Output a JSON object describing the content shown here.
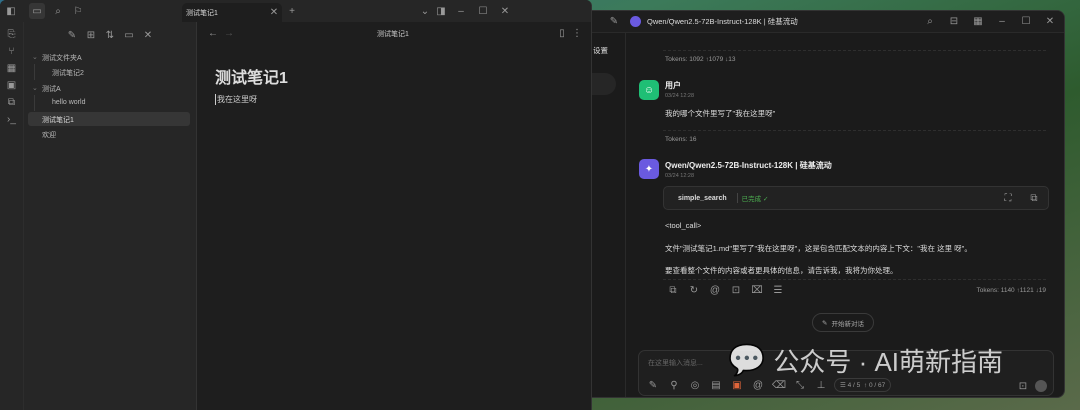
{
  "obsidian": {
    "tab_title": "测试笔记1",
    "header_title": "测试笔记1",
    "files": [
      {
        "label": "测试文件夹A",
        "type": "folder"
      },
      {
        "label": "测试笔记2",
        "type": "file"
      },
      {
        "label": "测试A",
        "type": "folder"
      },
      {
        "label": "hello world",
        "type": "file"
      },
      {
        "label": "测试笔记1",
        "type": "file",
        "active": true
      },
      {
        "label": "欢迎",
        "type": "file"
      }
    ],
    "note_title": "测试笔记1",
    "note_body": "我在这里呀"
  },
  "chat": {
    "window_title": "Qwen/Qwen2.5-72B-Instruct-128K | 硅基流动",
    "sidebar_label": "设置",
    "tokens_top": "Tokens: 1092 ↑1079 ↓13",
    "user": {
      "name": "用户",
      "time": "03/24 12:28",
      "text": "我的哪个文件里写了\"我在这里呀\"",
      "tokens": "Tokens: 16"
    },
    "assistant": {
      "name": "Qwen/Qwen2.5-72B-Instruct-128K | 硅基流动",
      "time": "03/24 12:28",
      "tool_name": "simple_search",
      "tool_status": "已完成 ✓",
      "line1": "<tool_call>",
      "line2": "文件\"测试笔记1.md\"里写了\"我在这里呀\"，这是包含匹配文本的内容上下文：\"我在 这里 呀\"。",
      "line3": "要查看整个文件的内容或者更具体的信息，请告诉我，我将为你处理。",
      "tokens": "Tokens: 1140 ↑1121 ↓19"
    },
    "new_chat_label": "开始新对话",
    "input_placeholder": "在这里输入消息...",
    "counter": "☰ 4 / 5  ↑ 0 / 67",
    "accent_user": "#1fbf75",
    "accent_model": "#6a5ae0",
    "status_color": "#4caf50"
  },
  "watermark": "公众号 · AI萌新指南"
}
